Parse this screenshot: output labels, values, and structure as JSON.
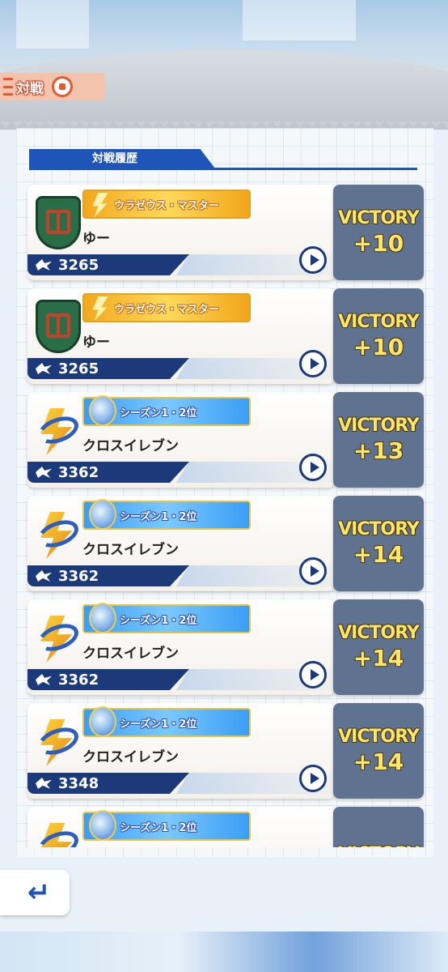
{
  "header": {
    "title": "対戦"
  },
  "section": {
    "title": "対戦履歴"
  },
  "matches": [
    {
      "emblem": "raimon-emblem",
      "badge_style": "gold",
      "badge": "ウラゼウス・マスター",
      "name": "ゆー",
      "power": "3265",
      "result": "VICTORY",
      "points": "+10"
    },
    {
      "emblem": "raimon-emblem",
      "badge_style": "gold",
      "badge": "ウラゼウス・マスター",
      "name": "ゆー",
      "power": "3265",
      "result": "VICTORY",
      "points": "+10"
    },
    {
      "emblem": "cross-emblem",
      "badge_style": "blue",
      "badge": "シーズン1・2位",
      "name": "クロスイレブン",
      "power": "3362",
      "result": "VICTORY",
      "points": "+13"
    },
    {
      "emblem": "cross-emblem",
      "badge_style": "blue",
      "badge": "シーズン1・2位",
      "name": "クロスイレブン",
      "power": "3362",
      "result": "VICTORY",
      "points": "+14"
    },
    {
      "emblem": "cross-emblem",
      "badge_style": "blue",
      "badge": "シーズン1・2位",
      "name": "クロスイレブン",
      "power": "3362",
      "result": "VICTORY",
      "points": "+14"
    },
    {
      "emblem": "cross-emblem",
      "badge_style": "blue",
      "badge": "シーズン1・2位",
      "name": "クロスイレブン",
      "power": "3348",
      "result": "VICTORY",
      "points": "+14"
    },
    {
      "emblem": "cross-emblem",
      "badge_style": "blue",
      "badge": "シーズン1・2位",
      "name": "",
      "power": "",
      "result": "VICTORY",
      "points": ""
    }
  ],
  "back": {
    "icon": "return-arrow-icon"
  },
  "colors": {
    "accent": "#1f55b8",
    "result_bg": "#5f7391",
    "victory_text": "#ffe46a"
  }
}
